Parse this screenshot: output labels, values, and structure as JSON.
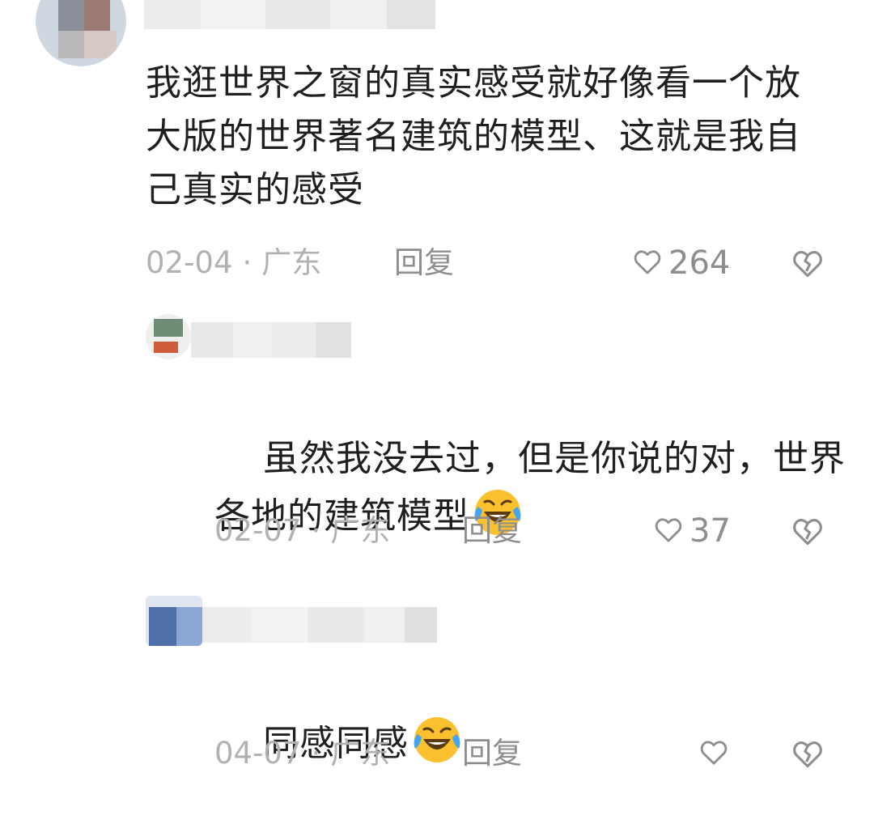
{
  "comments": [
    {
      "text": "我逛世界之窗的真实感受就好像看一个放大版的世界著名建筑的模型、这就是我自己真实的感受",
      "date": "02-04",
      "location": "广东",
      "reply_label": "回复",
      "likes": "264"
    },
    {
      "text": "虽然我没去过，但是你说的对，世界各地的建筑模型",
      "emoji": "rolling-on-floor-laughing-emoji",
      "date": "02-07",
      "location": "广东",
      "reply_label": "回复",
      "likes": "37"
    },
    {
      "text": "同感同感",
      "emoji": "rolling-on-floor-laughing-emoji",
      "date": "04-07",
      "location": "广东",
      "reply_label": "回复",
      "likes": ""
    }
  ],
  "meta_separator": "·",
  "icons": {
    "like": "heart-outline-icon",
    "dislike": "broken-heart-icon"
  },
  "colors": {
    "text": "#1f1f1f",
    "meta": "#b1b1b1",
    "icon": "#8e8e8e",
    "emoji_face": "#fbc02d",
    "emoji_tears": "#42a5f5"
  }
}
